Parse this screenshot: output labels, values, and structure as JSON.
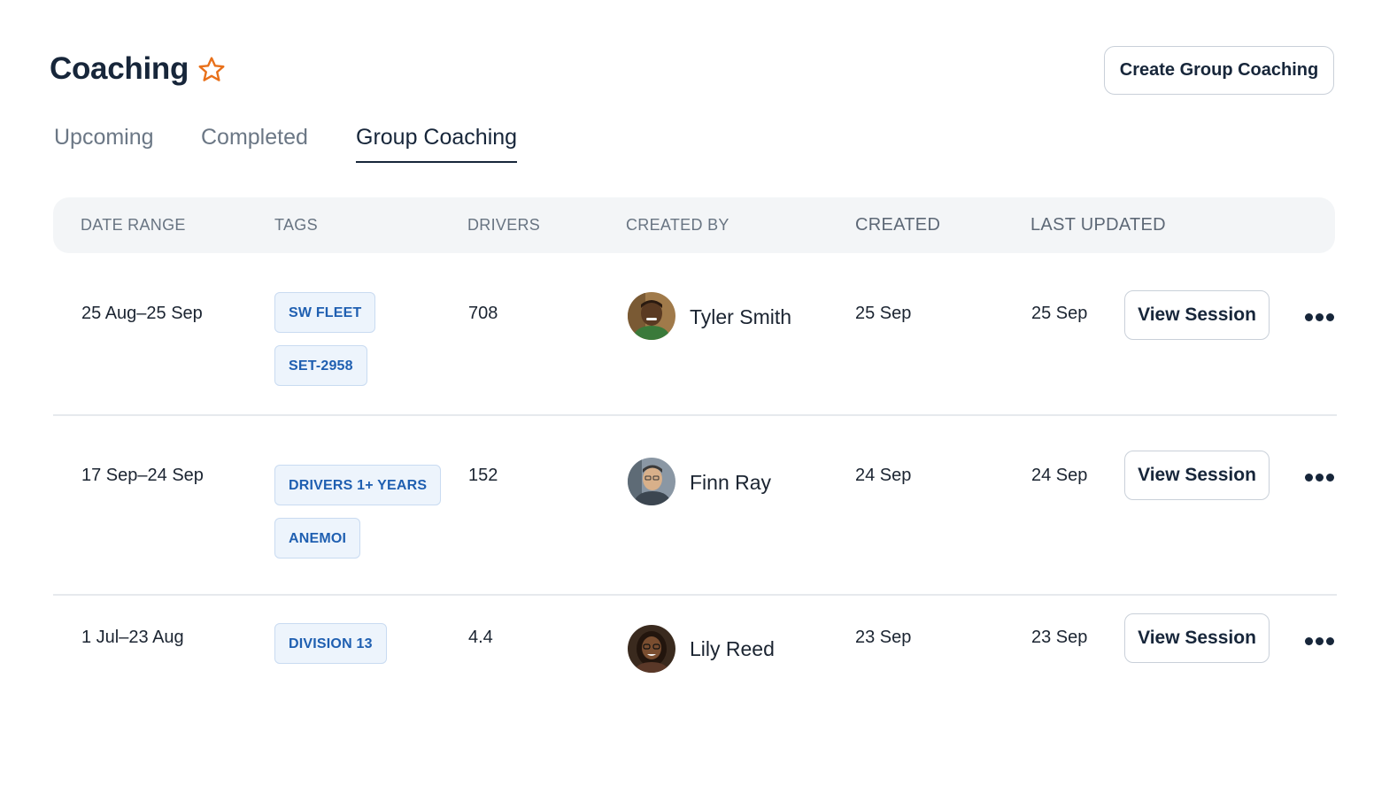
{
  "header": {
    "title": "Coaching",
    "favorite_icon": "star-icon",
    "accent_color": "#e8701a",
    "create_label": "Create Group Coaching"
  },
  "tabs": [
    {
      "label": "Upcoming",
      "active": false
    },
    {
      "label": "Completed",
      "active": false
    },
    {
      "label": "Group Coaching",
      "active": true
    }
  ],
  "table": {
    "columns": [
      "DATE RANGE",
      "TAGS",
      "DRIVERS",
      "CREATED BY",
      "CREATED",
      "LAST UPDATED"
    ],
    "rows": [
      {
        "date_range": "25 Aug–25 Sep",
        "tags": [
          "SW FLEET",
          "SET-2958"
        ],
        "drivers": "708",
        "created_by": "Tyler Smith",
        "created": "25 Sep",
        "last_updated": "25 Sep",
        "action_label": "View Session"
      },
      {
        "date_range": "17 Sep–24 Sep",
        "tags": [
          "DRIVERS 1+ YEARS",
          "ANEMOI"
        ],
        "drivers": "152",
        "created_by": "Finn Ray",
        "created": "24 Sep",
        "last_updated": "24 Sep",
        "action_label": "View Session"
      },
      {
        "date_range": "1 Jul–23 Aug",
        "tags": [
          "DIVISION 13"
        ],
        "drivers": "4.4",
        "created_by": "Lily Reed",
        "created": "23 Sep",
        "last_updated": "23 Sep",
        "action_label": "View Session"
      }
    ]
  },
  "icons": {
    "more": "more-horizontal-icon",
    "avatar": "avatar"
  },
  "colors": {
    "tag_text": "#1f5fb1",
    "tag_bg": "#edf4fc",
    "primary_text": "#17263a"
  }
}
